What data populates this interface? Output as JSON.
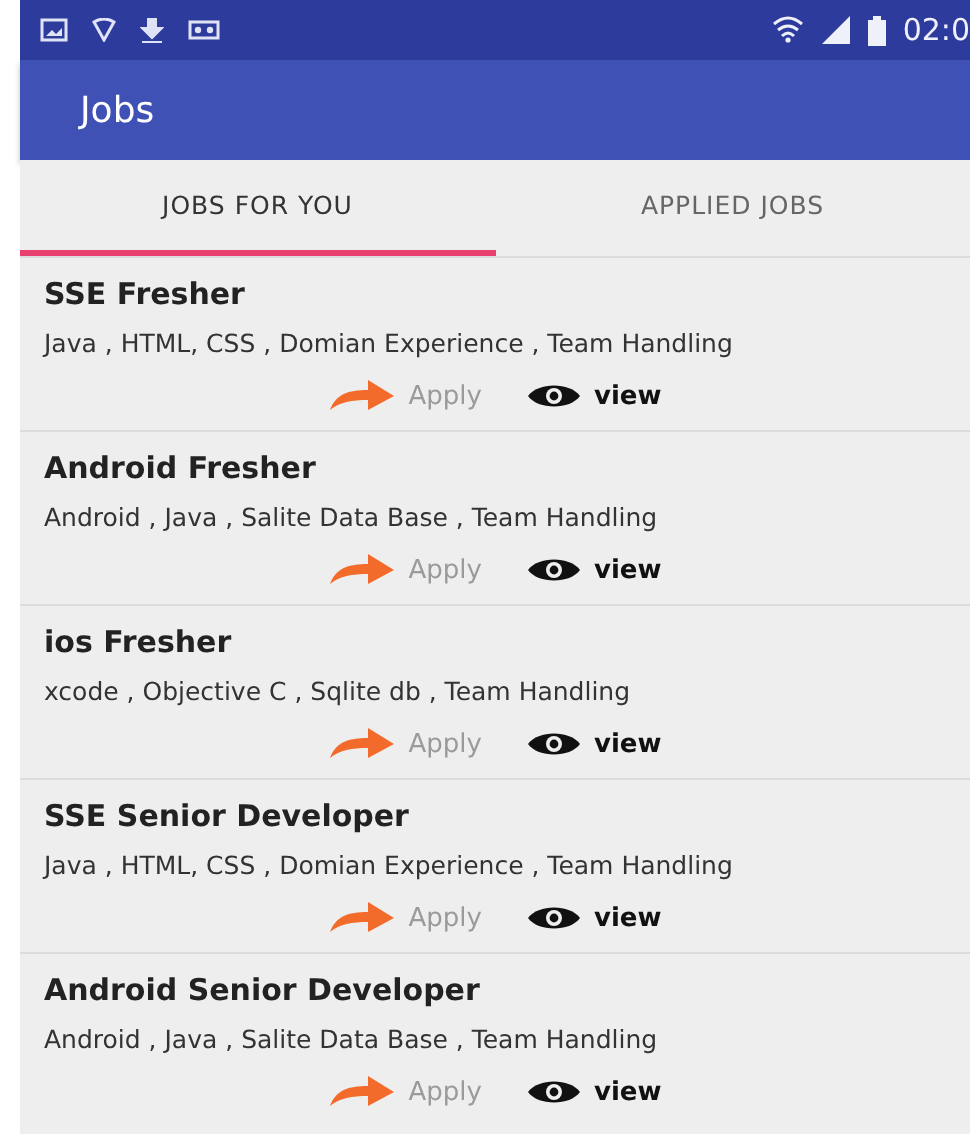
{
  "status_bar": {
    "time": "02:0"
  },
  "app_bar": {
    "title": "Jobs"
  },
  "tabs": [
    {
      "label": "JOBS FOR YOU",
      "selected": true
    },
    {
      "label": "APPLIED JOBS",
      "selected": false
    }
  ],
  "jobs": [
    {
      "title": "SSE Fresher",
      "skills": "Java , HTML, CSS , Domian Experience , Team Handling",
      "apply": "Apply",
      "view": "view"
    },
    {
      "title": "Android Fresher",
      "skills": "Android , Java , Salite Data Base , Team Handling",
      "apply": "Apply",
      "view": "view"
    },
    {
      "title": "ios Fresher",
      "skills": "xcode , Objective C , Sqlite db , Team Handling",
      "apply": "Apply",
      "view": "view"
    },
    {
      "title": "SSE Senior Developer",
      "skills": "Java , HTML, CSS , Domian Experience , Team Handling",
      "apply": "Apply",
      "view": "view"
    },
    {
      "title": "Android Senior Developer",
      "skills": "Android , Java , Salite Data Base , Team Handling",
      "apply": "Apply",
      "view": "view"
    }
  ]
}
